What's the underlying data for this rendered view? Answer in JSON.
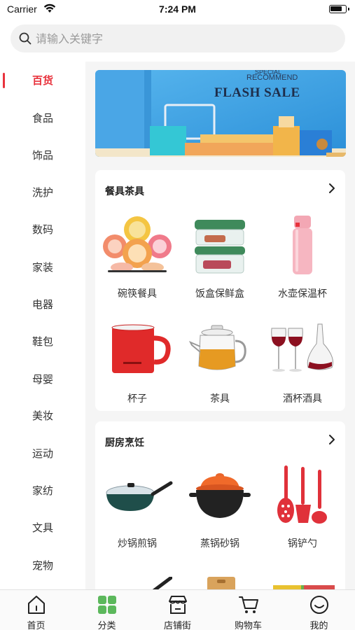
{
  "status_bar": {
    "carrier": "Carrier",
    "time": "7:24 PM"
  },
  "search": {
    "placeholder": "请输入关键字"
  },
  "sidebar": {
    "active_index": 0,
    "items": [
      "百货",
      "食品",
      "饰品",
      "洗护",
      "数码",
      "家装",
      "电器",
      "鞋包",
      "母婴",
      "美妆",
      "运动",
      "家纺",
      "文具",
      "宠物"
    ]
  },
  "banner": {
    "line1": "SPECIAL",
    "line2": "RECOMMEND",
    "headline": "FLASH SALE"
  },
  "sections": [
    {
      "title": "餐具茶具",
      "items": [
        {
          "label": "碗筷餐具",
          "icon": "tableware-set-icon"
        },
        {
          "label": "饭盒保鲜盒",
          "icon": "lunchbox-icon"
        },
        {
          "label": "水壶保温杯",
          "icon": "thermos-icon"
        },
        {
          "label": "杯子",
          "icon": "mug-icon"
        },
        {
          "label": "茶具",
          "icon": "teapot-icon"
        },
        {
          "label": "酒杯酒具",
          "icon": "wineglass-icon"
        }
      ]
    },
    {
      "title": "厨房烹饪",
      "items": [
        {
          "label": "炒锅煎锅",
          "icon": "wok-icon"
        },
        {
          "label": "蒸锅砂锅",
          "icon": "casserole-icon"
        },
        {
          "label": "锅铲勺",
          "icon": "spatula-icon"
        }
      ]
    }
  ],
  "tabbar": {
    "active_index": 1,
    "items": [
      "首页",
      "分类",
      "店铺街",
      "购物车",
      "我的"
    ]
  },
  "colors": {
    "accent": "#e8323c",
    "category_icon": "#5cb85c"
  }
}
